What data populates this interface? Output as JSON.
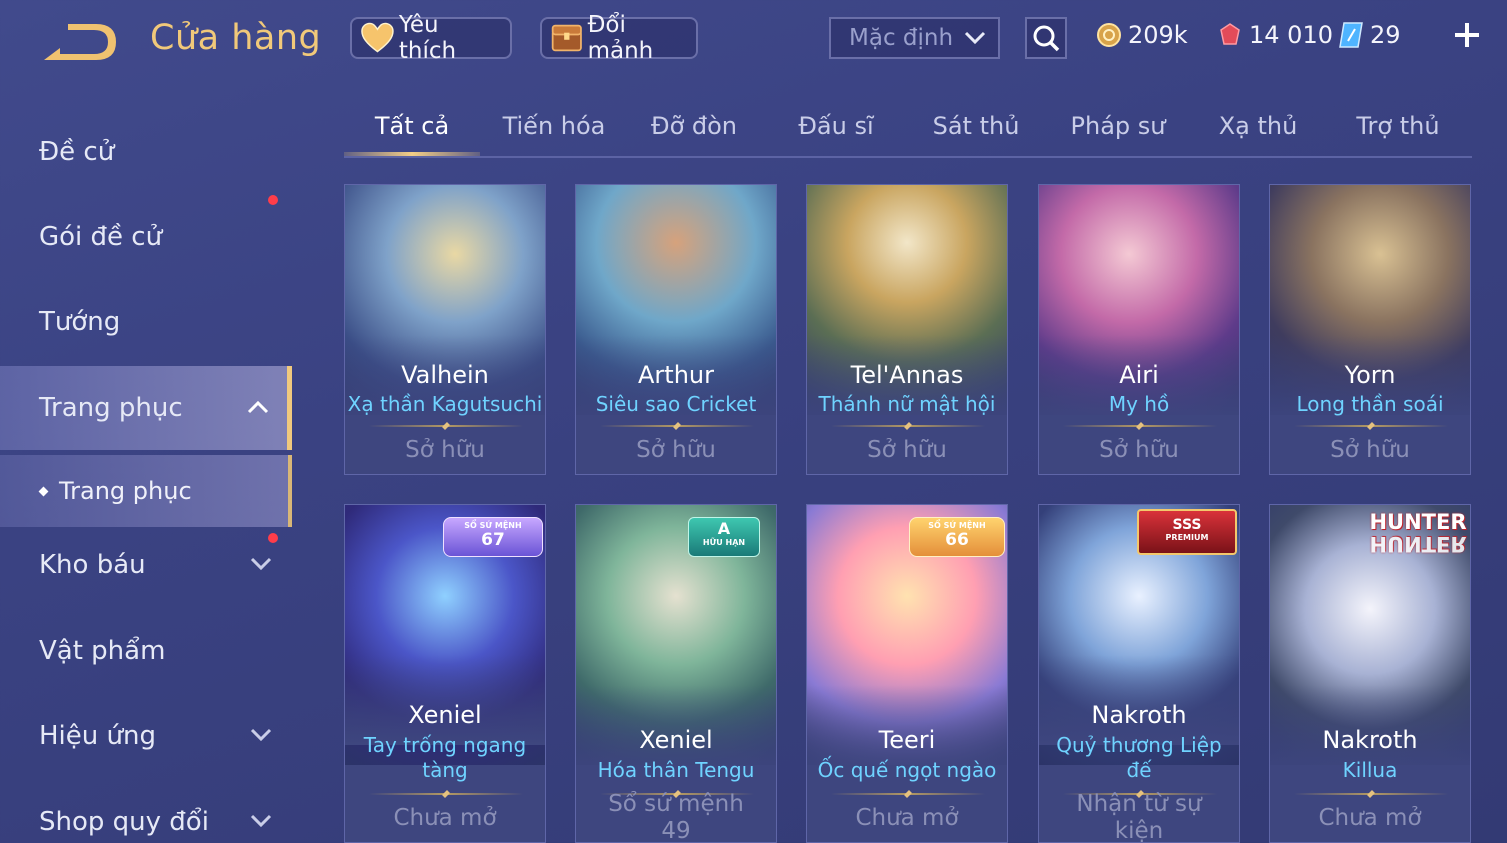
{
  "header": {
    "title": "Cửa hàng",
    "favorite_label": "Yêu thích",
    "shard_label": "Đổi mảnh",
    "sort_value": "Mặc định",
    "currencies": {
      "gold": "209k",
      "ruby": "14 010",
      "voucher": "29"
    }
  },
  "sidebar": {
    "items": [
      {
        "label": "Đề cử"
      },
      {
        "label": "Gói đề cử"
      },
      {
        "label": "Tướng"
      },
      {
        "label": "Trang phục"
      },
      {
        "label": "Kho báu"
      },
      {
        "label": "Vật phẩm"
      },
      {
        "label": "Hiệu ứng"
      },
      {
        "label": "Shop quy đổi"
      }
    ],
    "sub_item": "Trang phục"
  },
  "tabs": [
    "Tất cả",
    "Tiến hóa",
    "Đỡ đòn",
    "Đấu sĩ",
    "Sát thủ",
    "Pháp sư",
    "Xạ thủ",
    "Trợ thủ"
  ],
  "cards": [
    {
      "hero": "Valhein",
      "skin": "Xạ thần Kagutsuchi",
      "status": "Sở hữu"
    },
    {
      "hero": "Arthur",
      "skin": "Siêu sao Cricket",
      "status": "Sở hữu"
    },
    {
      "hero": "Tel'Annas",
      "skin": "Thánh nữ mật hội",
      "status": "Sở hữu"
    },
    {
      "hero": "Airi",
      "skin": "My hồ",
      "status": "Sở hữu"
    },
    {
      "hero": "Yorn",
      "skin": "Long thần soái",
      "status": "Sở hữu"
    },
    {
      "hero": "Xeniel",
      "skin": "Tay trống ngang tàng",
      "status": "Chưa mở",
      "badge_small": "SỔ SỨ MỆNH",
      "badge_big": "67"
    },
    {
      "hero": "Xeniel",
      "skin": "Hóa thân Tengu",
      "status": "Sổ sứ mệnh 49",
      "badge_small": "HỮU HẠN",
      "badge_big": "A"
    },
    {
      "hero": "Teeri",
      "skin": "Ốc quế ngọt ngào",
      "status": "Chưa mở",
      "badge_small": "SỔ SỨ MỆNH",
      "badge_big": "66"
    },
    {
      "hero": "Nakroth",
      "skin": "Quỷ thương Liệp đế",
      "status": "Nhận từ sự kiện",
      "badge_small": "PREMIUM",
      "badge_big": "SSS"
    },
    {
      "hero": "Nakroth",
      "skin": "Killua",
      "status": "Chưa mở",
      "badge_big": "HUNTER",
      "badge_small": "HUNTER"
    }
  ],
  "colors": {
    "accent_gold": "#f1c97a",
    "skin_name": "#6fd3ff",
    "notification": "#ff3d4a"
  }
}
